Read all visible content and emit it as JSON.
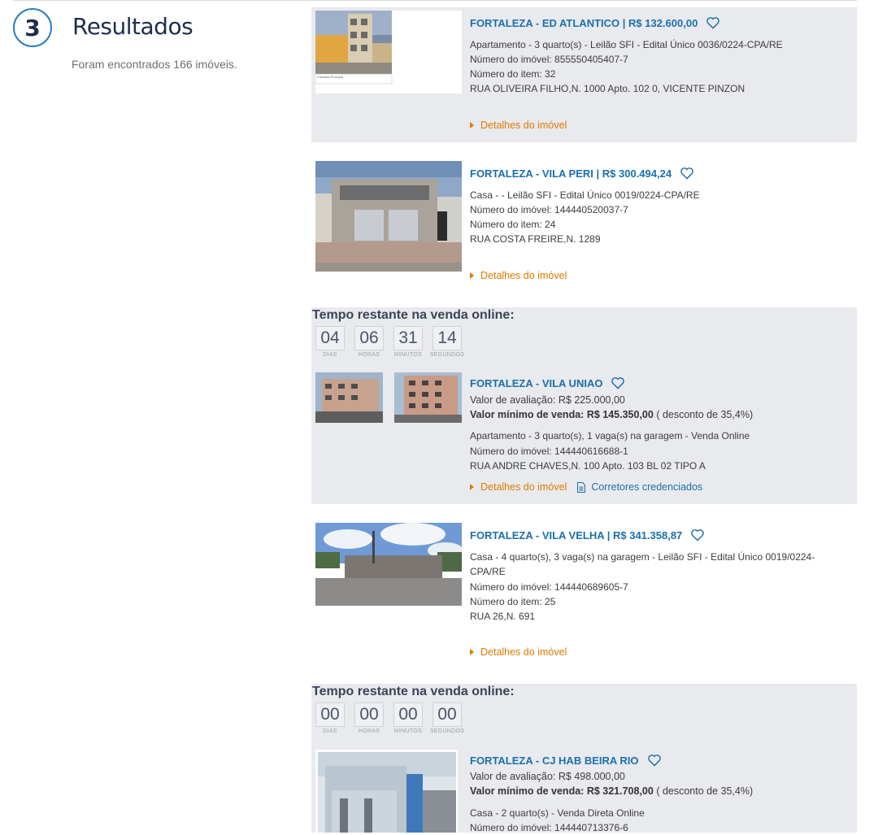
{
  "header": {
    "step_number": "3",
    "title": "Resultados",
    "count_text": "Foram encontrados 166 imóveis."
  },
  "colors": {
    "accent": "#1a6fae",
    "link_orange": "#e07a00",
    "card_gray": "#e9eaed",
    "circle": "#2a7fbf"
  },
  "timer": {
    "title": "Tempo restante na venda online:",
    "labels": {
      "days": "DIAS",
      "hours": "HORAS",
      "minutes": "MINUTOS",
      "seconds": "SEGUNDOS"
    }
  },
  "listings": [
    {
      "title": "FORTALEZA - ED ATLANTICO | R$ 132.600,00",
      "desc": "Apartamento - 3 quarto(s) - Leilão SFI - Edital Único 0036/0224-CPA/RE",
      "imovel": "Número do imóvel: 855550405407-7",
      "item": "Número do item: 32",
      "address": "RUA OLIVEIRA FILHO,N. 1000 Apto. 102 0, VICENTE PINZON",
      "photo_caption": "Fachada Principal",
      "details": "Detalhes do imóvel"
    },
    {
      "title": "FORTALEZA - VILA PERI | R$ 300.494,24",
      "desc": "Casa - - Leilão SFI - Edital Único 0019/0224-CPA/RE",
      "imovel": "Número do imóvel: 144440520037-7",
      "item": "Número do item: 24",
      "address": "RUA COSTA FREIRE,N. 1289",
      "details": "Detalhes do imóvel"
    },
    {
      "timer": {
        "days": "04",
        "hours": "06",
        "minutes": "31",
        "seconds": "14"
      },
      "title": "FORTALEZA - VILA UNIAO",
      "valor_avaliacao": "Valor de avaliação: R$ 225.000,00",
      "valor_minimo_label": "Valor mínimo de venda:",
      "valor_minimo_value": "R$ 145.350,00",
      "desconto": "( desconto de 35,4%)",
      "desc": "Apartamento - 3 quarto(s), 1 vaga(s) na garagem - Venda Online",
      "imovel": "Número do imóvel: 144440616688-1",
      "address": "RUA ANDRE CHAVES,N. 100 Apto. 103 BL 02 TIPO A",
      "details": "Detalhes do imóvel",
      "corretores": "Corretores credenciados"
    },
    {
      "title": "FORTALEZA - VILA VELHA | R$ 341.358,87",
      "desc_line1": "Casa - 4 quarto(s), 3 vaga(s) na garagem - Leilão SFI - Edital Único 0019/0224-",
      "desc_line2": "CPA/RE",
      "imovel": "Número do imóvel: 144440689605-7",
      "item": "Número do item: 25",
      "address": "RUA 26,N. 691",
      "details": "Detalhes do imóvel"
    },
    {
      "timer": {
        "days": "00",
        "hours": "00",
        "minutes": "00",
        "seconds": "00"
      },
      "title": "FORTALEZA - CJ HAB BEIRA RIO",
      "valor_avaliacao": "Valor de avaliação: R$ 498.000,00",
      "valor_minimo_label": "Valor mínimo de venda:",
      "valor_minimo_value": "R$ 321.708,00",
      "desconto": "( desconto de 35,4%)",
      "desc": "Casa - 2 quarto(s) - Venda Direta Online",
      "imovel": "Número do imóvel: 144440713376-6"
    }
  ]
}
